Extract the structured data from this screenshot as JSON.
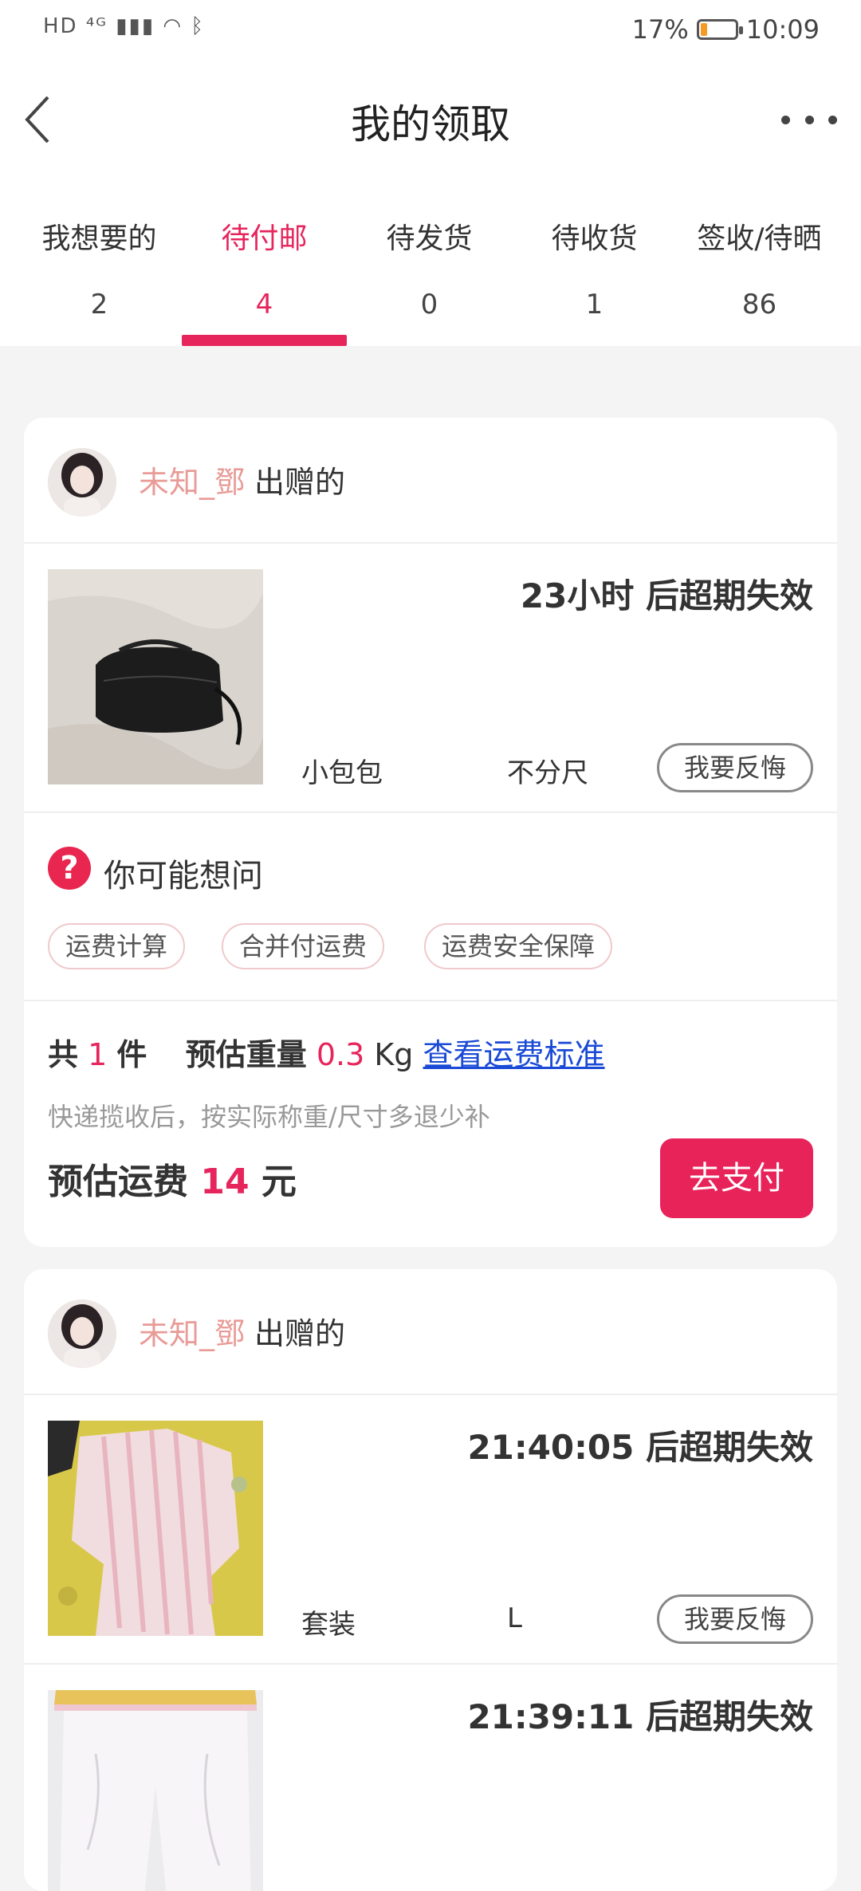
{
  "status_bar": {
    "network": "HD ⁴ᴳ",
    "battery_percent": "17%",
    "battery_level": 0.17,
    "time": "10:09"
  },
  "nav": {
    "title": "我的领取",
    "back_icon": "chevron-left-icon",
    "more_icon": "more-dots-icon"
  },
  "tabs": [
    {
      "label": "我想要的",
      "count": "2"
    },
    {
      "label": "待付邮",
      "count": "4",
      "active": true
    },
    {
      "label": "待发货",
      "count": "0"
    },
    {
      "label": "待收货",
      "count": "1"
    },
    {
      "label": "签收/待晒",
      "count": "86"
    }
  ],
  "card1": {
    "donor_name": "未知_鄧",
    "donor_suffix": "出赠的",
    "item": {
      "expire_text": "23小时 后超期失效",
      "name": "小包包",
      "size": "不分尺",
      "regret_label": "我要反悔"
    },
    "ask": {
      "icon": "question-icon",
      "title": "你可能想问",
      "chips": [
        "运费计算",
        "合并付运费",
        "运费安全保障"
      ]
    },
    "summary": {
      "total_prefix": "共",
      "total_count": "1",
      "total_suffix": "件",
      "weight_label": "预估重量",
      "weight_value": "0.3",
      "weight_unit": "Kg",
      "link_text": "查看运费标准",
      "note": "快递揽收后，按实际称重/尺寸多退少补",
      "fee_label": "预估运费",
      "fee_value": "14",
      "fee_unit": "元",
      "pay_label": "去支付"
    }
  },
  "card2": {
    "donor_name": "未知_鄧",
    "donor_suffix": "出赠的",
    "items": [
      {
        "expire_text": "21:40:05 后超期失效",
        "name": "套装",
        "size": "L",
        "regret_label": "我要反悔"
      },
      {
        "expire_text": "21:39:11 后超期失效"
      }
    ]
  },
  "colors": {
    "accent": "#e6255c",
    "donor_name": "#e89b97",
    "link": "#1a4ad6"
  }
}
